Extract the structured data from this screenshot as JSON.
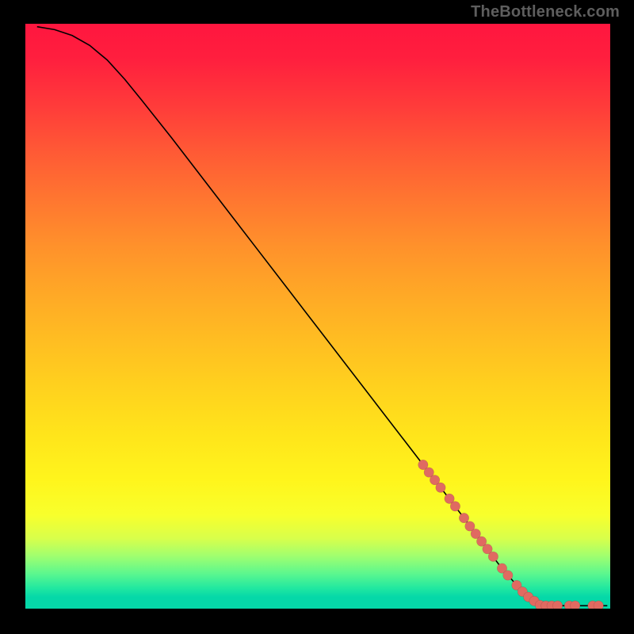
{
  "watermark": "TheBottleneck.com",
  "colors": {
    "dot_fill": "#e06a61",
    "curve_stroke": "#000000",
    "background_black": "#000000",
    "gradient_top": "#ff163f",
    "gradient_bottom": "#05d8a8"
  },
  "chart_data": {
    "type": "line",
    "title": "",
    "xlabel": "",
    "ylabel": "",
    "xlim": [
      0,
      100
    ],
    "ylim": [
      0,
      100
    ],
    "grid": false,
    "axes_visible": false,
    "curve": [
      {
        "x": 2.0,
        "y": 99.5
      },
      {
        "x": 5.0,
        "y": 99.0
      },
      {
        "x": 8.0,
        "y": 98.0
      },
      {
        "x": 11.0,
        "y": 96.3
      },
      {
        "x": 14.0,
        "y": 93.8
      },
      {
        "x": 17.0,
        "y": 90.5
      },
      {
        "x": 20.0,
        "y": 86.8
      },
      {
        "x": 25.0,
        "y": 80.5
      },
      {
        "x": 30.0,
        "y": 74.0
      },
      {
        "x": 35.0,
        "y": 67.5
      },
      {
        "x": 40.0,
        "y": 61.0
      },
      {
        "x": 45.0,
        "y": 54.5
      },
      {
        "x": 50.0,
        "y": 48.0
      },
      {
        "x": 55.0,
        "y": 41.5
      },
      {
        "x": 60.0,
        "y": 35.0
      },
      {
        "x": 65.0,
        "y": 28.5
      },
      {
        "x": 70.0,
        "y": 22.0
      },
      {
        "x": 74.0,
        "y": 16.8
      },
      {
        "x": 78.0,
        "y": 11.5
      },
      {
        "x": 81.0,
        "y": 7.5
      },
      {
        "x": 84.0,
        "y": 4.0
      },
      {
        "x": 86.0,
        "y": 2.0
      },
      {
        "x": 87.5,
        "y": 1.0
      },
      {
        "x": 89.0,
        "y": 0.6
      },
      {
        "x": 92.0,
        "y": 0.5
      },
      {
        "x": 96.0,
        "y": 0.5
      },
      {
        "x": 99.5,
        "y": 0.5
      }
    ],
    "series": [
      {
        "name": "highlighted-points",
        "type": "scatter",
        "marker_radius": 6.2,
        "points": [
          {
            "x": 68.0,
            "y": 24.6
          },
          {
            "x": 69.0,
            "y": 23.3
          },
          {
            "x": 70.0,
            "y": 22.0
          },
          {
            "x": 71.0,
            "y": 20.7
          },
          {
            "x": 72.5,
            "y": 18.8
          },
          {
            "x": 73.5,
            "y": 17.5
          },
          {
            "x": 75.0,
            "y": 15.5
          },
          {
            "x": 76.0,
            "y": 14.1
          },
          {
            "x": 77.0,
            "y": 12.8
          },
          {
            "x": 78.0,
            "y": 11.5
          },
          {
            "x": 79.0,
            "y": 10.2
          },
          {
            "x": 80.0,
            "y": 8.9
          },
          {
            "x": 81.5,
            "y": 6.9
          },
          {
            "x": 82.5,
            "y": 5.7
          },
          {
            "x": 84.0,
            "y": 4.0
          },
          {
            "x": 85.0,
            "y": 2.9
          },
          {
            "x": 86.0,
            "y": 2.0
          },
          {
            "x": 87.0,
            "y": 1.3
          },
          {
            "x": 88.0,
            "y": 0.6
          },
          {
            "x": 89.0,
            "y": 0.5
          },
          {
            "x": 90.0,
            "y": 0.5
          },
          {
            "x": 91.0,
            "y": 0.5
          },
          {
            "x": 93.0,
            "y": 0.5
          },
          {
            "x": 94.0,
            "y": 0.5
          },
          {
            "x": 97.0,
            "y": 0.5
          },
          {
            "x": 98.0,
            "y": 0.5
          }
        ]
      }
    ]
  }
}
